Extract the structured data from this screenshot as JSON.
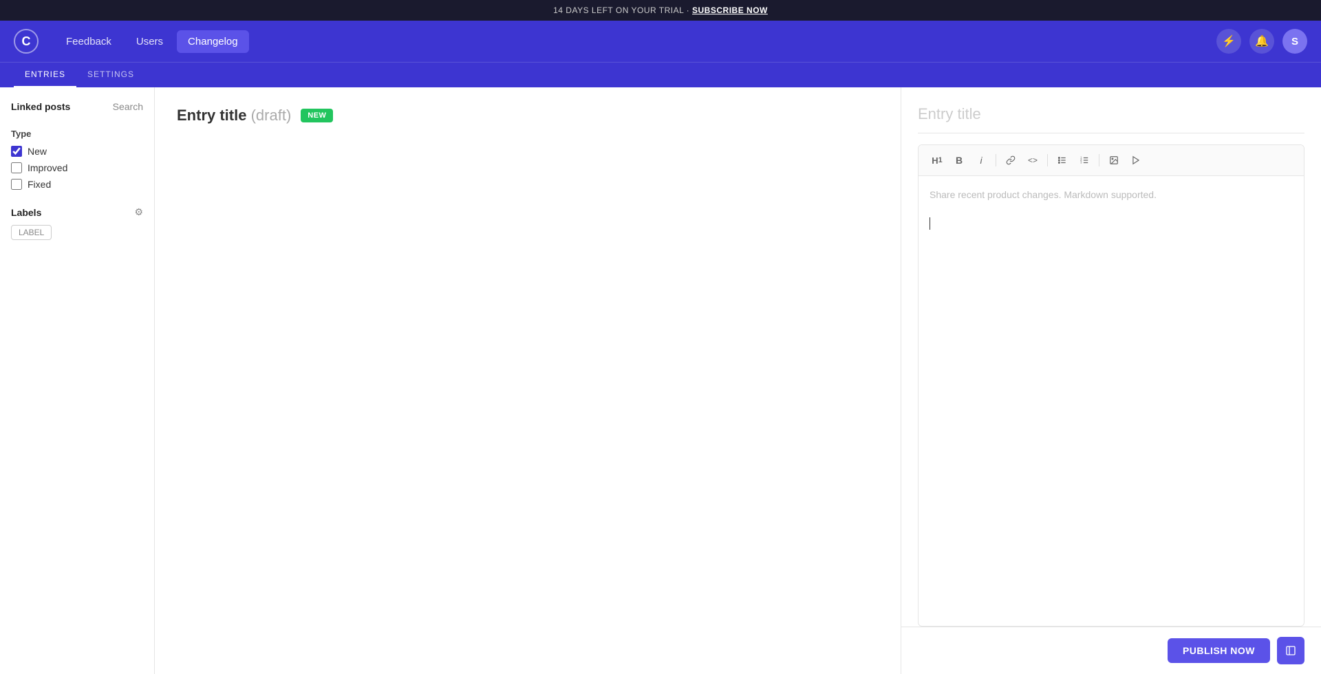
{
  "trial_banner": {
    "text": "14 DAYS LEFT ON YOUR TRIAL · ",
    "link_text": "SUBSCRIBE NOW"
  },
  "nav": {
    "logo": "C",
    "links": [
      {
        "label": "Feedback",
        "active": false
      },
      {
        "label": "Users",
        "active": false
      },
      {
        "label": "Changelog",
        "active": true
      }
    ],
    "icons": {
      "lightning": "⚡",
      "bell": "🔔",
      "avatar": "S"
    }
  },
  "sub_nav": {
    "items": [
      {
        "label": "ENTRIES",
        "active": true
      },
      {
        "label": "SETTINGS",
        "active": false
      }
    ]
  },
  "sidebar": {
    "linked_posts": "Linked posts",
    "search": "Search",
    "type_label": "Type",
    "type_items": [
      {
        "label": "New",
        "checked": true
      },
      {
        "label": "Improved",
        "checked": false
      },
      {
        "label": "Fixed",
        "checked": false
      }
    ],
    "labels_title": "Labels",
    "label_tag": "LABEL"
  },
  "center_panel": {
    "entry_title": "Entry title",
    "entry_draft": "(draft)",
    "badge": "NEW"
  },
  "editor": {
    "title_placeholder": "Entry title",
    "content_placeholder": "Share recent product changes. Markdown supported.",
    "toolbar": {
      "h1": "H₁",
      "bold": "B",
      "italic": "i",
      "link": "🔗",
      "code": "<>",
      "ul": "☰",
      "ol": "≡",
      "image": "🖼",
      "video": "▶"
    }
  },
  "footer": {
    "publish_btn": "PUBLISH NOW"
  }
}
